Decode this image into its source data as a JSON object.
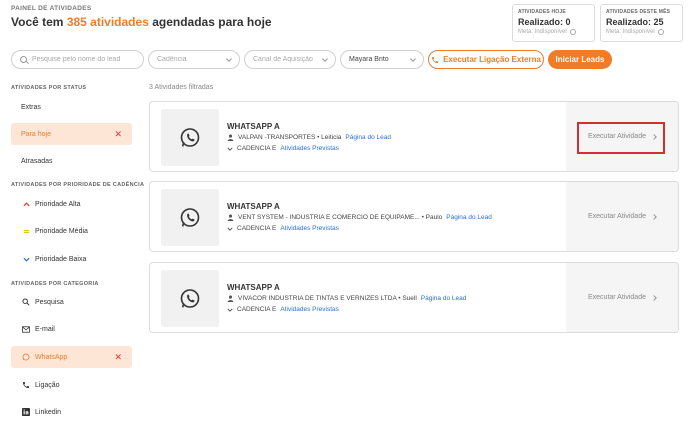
{
  "header": {
    "kicker": "PAINEL DE ATIVIDADES",
    "title_prefix": "Você tem ",
    "title_count": "385 atividades",
    "title_suffix": " agendadas para hoje"
  },
  "stats": [
    {
      "label": "ATIVIDADES HOJE",
      "value": "Realizado: 0",
      "meta": "Meta: Indisponível"
    },
    {
      "label": "ATIVIDADES DESTE MÊS",
      "value": "Realizado: 25",
      "meta": "Meta: Indisponível"
    }
  ],
  "filters": {
    "search_placeholder": "Pesquise pelo nome do lead",
    "cadence": "Cadência",
    "channel": "Canal de Aquisição",
    "user": "Mayara Brito"
  },
  "actions": {
    "external_call": "Executar Ligação Externa",
    "start_leads": "Iniciar Leads"
  },
  "sidebar": {
    "status_heading": "ATIVIDADES POR STATUS",
    "status_items": [
      {
        "label": "Extras"
      },
      {
        "label": "Para hoje"
      },
      {
        "label": "Atrasadas"
      }
    ],
    "priority_heading": "ATIVIDADES POR PRIORIDADE DE CADÊNCIA",
    "priority_items": [
      {
        "label": "Prioridade Alta"
      },
      {
        "label": "Prioridade Média"
      },
      {
        "label": "Prioridade Baixa"
      }
    ],
    "category_heading": "ATIVIDADES POR CATEGORIA",
    "category_items": [
      {
        "label": "Pesquisa"
      },
      {
        "label": "E-mail"
      },
      {
        "label": "WhatsApp"
      },
      {
        "label": "Ligação"
      },
      {
        "label": "Linkedin"
      }
    ],
    "remove_glyph": "✕"
  },
  "main": {
    "filtered_count": "3 Atividades filtradas",
    "cards": [
      {
        "title": "WHATSAPP A",
        "company": "VALPAN -TRANSPORTES • Leiticia",
        "lead_link": "Página do Lead",
        "cadence": "CADENCIA E",
        "activities_link": "Atividades Previstas",
        "execute": "Executar Atividade"
      },
      {
        "title": "WHATSAPP A",
        "company": "VENT SYSTEM - INDUSTRIA E COMERCIO DE EQUIPAME... • Paulo",
        "lead_link": "Página do Lead",
        "cadence": "CADENCIA E",
        "activities_link": "Atividades Previstas",
        "execute": "Executar Atividade"
      },
      {
        "title": "WHATSAPP A",
        "company": "VIVACOR INDUSTRIA DE TINTAS E VERNIZES LTDA • Suell",
        "lead_link": "Página do Lead",
        "cadence": "CADENCIA E",
        "activities_link": "Atividades Previstas",
        "execute": "Executar Atividade"
      }
    ]
  },
  "colors": {
    "accent": "#f07c2a",
    "link": "#2a6fdb",
    "remove": "#e53935",
    "highlight": "#d32f2f"
  }
}
